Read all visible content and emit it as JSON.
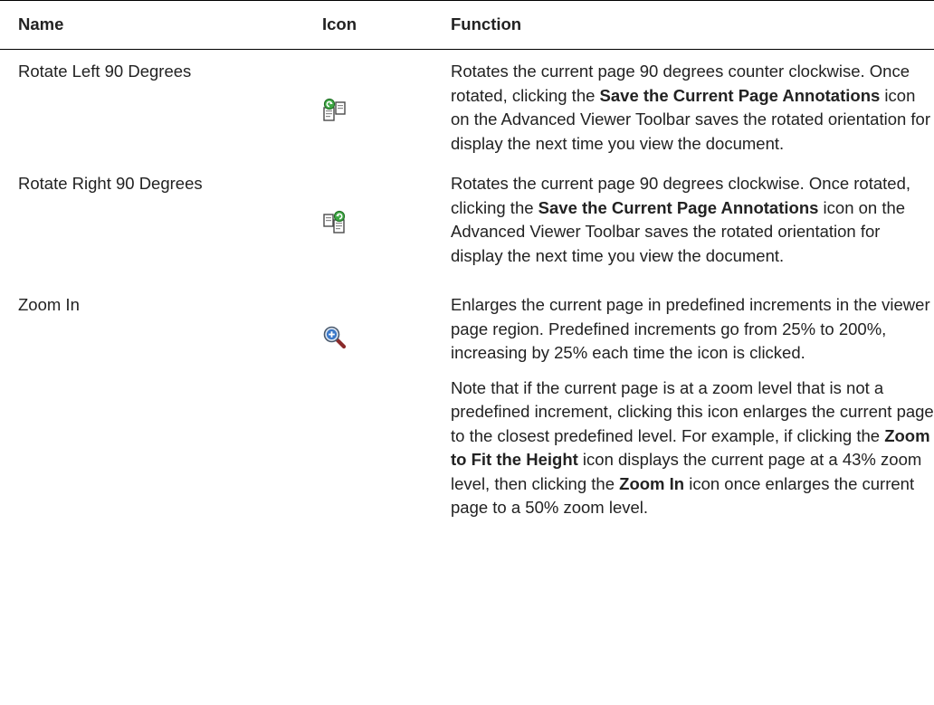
{
  "table": {
    "headers": {
      "name": "Name",
      "icon": "Icon",
      "function": "Function"
    },
    "rows": [
      {
        "name": "Rotate Left 90 Degrees",
        "icon": "rotate-left-icon",
        "function": [
          [
            {
              "text": "Rotates the current page 90 degrees counter clockwise. Once rotated, clicking the ",
              "bold": false
            },
            {
              "text": "Save the Current Page Annotations",
              "bold": true
            },
            {
              "text": " icon on the Advanced Viewer Toolbar saves the rotated orientation for display the next time you view the document.",
              "bold": false
            }
          ]
        ]
      },
      {
        "name": "Rotate Right 90 Degrees",
        "icon": "rotate-right-icon",
        "function": [
          [
            {
              "text": "Rotates the current page 90 degrees clockwise. Once rotated, clicking the ",
              "bold": false
            },
            {
              "text": "Save the Current Page Annotations",
              "bold": true
            },
            {
              "text": " icon on the Advanced Viewer Toolbar saves the rotated orientation for display the next time you view the document.",
              "bold": false
            }
          ]
        ]
      },
      {
        "name": "Zoom In",
        "icon": "zoom-in-icon",
        "function": [
          [
            {
              "text": "Enlarges the current page in predefined increments in the viewer page region. Predefined increments go from 25% to 200%, increasing by 25% each time the icon is clicked.",
              "bold": false
            }
          ],
          [
            {
              "text": "Note that if the current page is at a zoom level that is not a predefined increment, clicking this icon enlarges the current page to the closest predefined level. For example, if clicking the ",
              "bold": false
            },
            {
              "text": "Zoom to Fit the Height",
              "bold": true
            },
            {
              "text": " icon displays the current page at a 43% zoom level, then clicking the ",
              "bold": false
            },
            {
              "text": "Zoom In",
              "bold": true
            },
            {
              "text": " icon once enlarges the current page to a 50% zoom level.",
              "bold": false
            }
          ]
        ]
      }
    ]
  }
}
